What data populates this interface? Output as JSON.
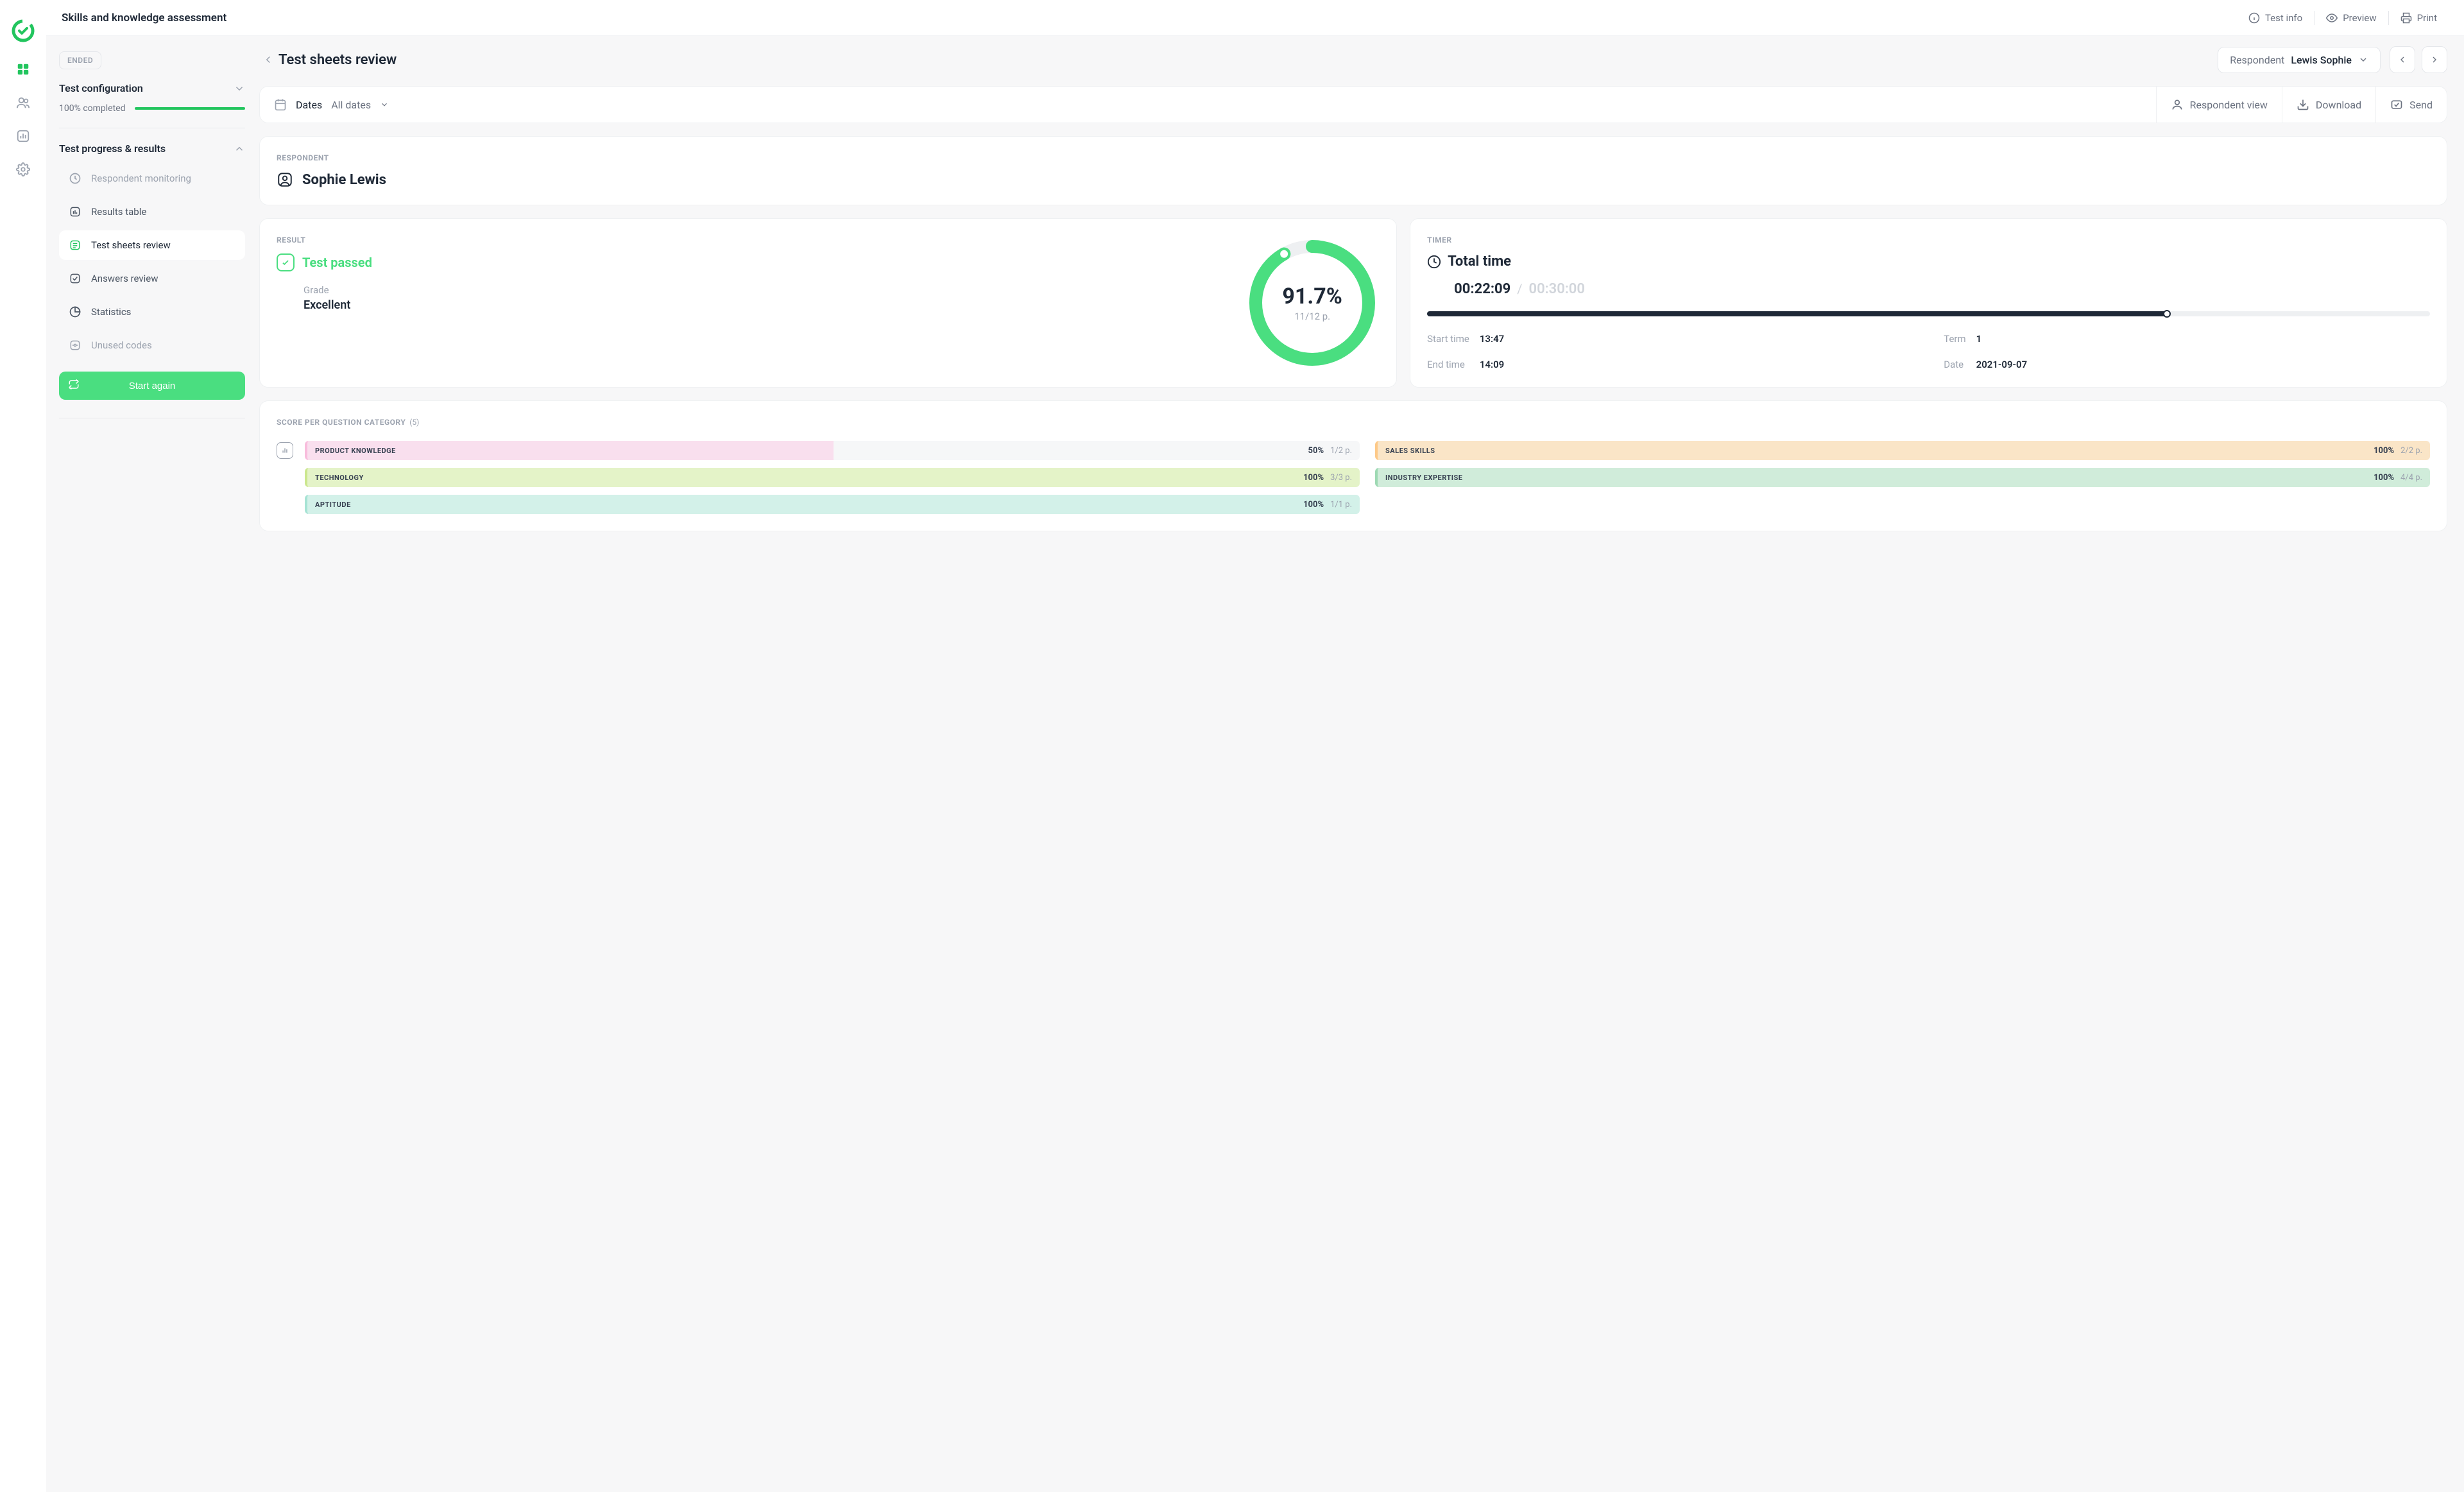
{
  "header": {
    "title": "Skills and knowledge assessment",
    "actions": {
      "test_info": "Test info",
      "preview": "Preview",
      "print": "Print"
    }
  },
  "sidebar": {
    "badge": "ENDED",
    "config": {
      "title": "Test configuration",
      "progress_text": "100% completed",
      "progress_pct": 100
    },
    "progress": {
      "title": "Test progress & results",
      "items": [
        {
          "label": "Respondent monitoring",
          "active": false
        },
        {
          "label": "Results table",
          "active": false
        },
        {
          "label": "Test sheets review",
          "active": true
        },
        {
          "label": "Answers review",
          "active": false
        },
        {
          "label": "Statistics",
          "active": false
        },
        {
          "label": "Unused codes",
          "active": false
        }
      ]
    },
    "start_again": "Start again"
  },
  "content": {
    "heading": "Test sheets review",
    "respondent_selector": {
      "label": "Respondent",
      "value": "Lewis Sophie"
    },
    "toolbar": {
      "dates_label": "Dates",
      "dates_value": "All dates",
      "respondent_view": "Respondent view",
      "download": "Download",
      "send": "Send"
    },
    "respondent_card": {
      "label": "RESPONDENT",
      "name": "Sophie Lewis"
    },
    "result_card": {
      "label": "RESULT",
      "status": "Test passed",
      "grade_label": "Grade",
      "grade_value": "Excellent",
      "percent": "91.7%",
      "points": "11/12 p.",
      "donut_pct": 91.7
    },
    "timer_card": {
      "label": "TIMER",
      "title": "Total time",
      "used": "00:22:09",
      "total": "00:30:00",
      "bar_pct": 73.8,
      "start_label": "Start time",
      "start_value": "13:47",
      "term_label": "Term",
      "term_value": "1",
      "end_label": "End time",
      "end_value": "14:09",
      "date_label": "Date",
      "date_value": "2021-09-07"
    },
    "score_card": {
      "label": "SCORE PER QUESTION CATEGORY",
      "count": "(5)",
      "categories": [
        {
          "name": "PRODUCT KNOWLEDGE",
          "percent": "50%",
          "points": "1/2 p.",
          "fill_pct": 50,
          "color": "#fbcfe8",
          "border": "#f8bcdc"
        },
        {
          "name": "TECHNOLOGY",
          "percent": "100%",
          "points": "3/3 p.",
          "fill_pct": 100,
          "color": "#d9f0a8",
          "border": "#cbe78e"
        },
        {
          "name": "APTITUDE",
          "percent": "100%",
          "points": "1/1 p.",
          "fill_pct": 100,
          "color": "#bcece0",
          "border": "#a6e3d4"
        },
        {
          "name": "SALES SKILLS",
          "percent": "100%",
          "points": "2/2 p.",
          "fill_pct": 100,
          "color": "#fed9a6",
          "border": "#fdc988"
        },
        {
          "name": "INDUSTRY EXPERTISE",
          "percent": "100%",
          "points": "4/4 p.",
          "fill_pct": 100,
          "color": "#b7e4c7",
          "border": "#9dd9b3"
        }
      ]
    }
  },
  "chart_data": [
    {
      "type": "pie",
      "title": "Result",
      "series": [
        {
          "name": "Score",
          "values": [
            91.7,
            8.3
          ]
        }
      ],
      "annotations": [
        "91.7%",
        "11/12 p."
      ]
    },
    {
      "type": "bar",
      "orientation": "horizontal",
      "title": "Score per question category",
      "categories": [
        "PRODUCT KNOWLEDGE",
        "TECHNOLOGY",
        "APTITUDE",
        "SALES SKILLS",
        "INDUSTRY EXPERTISE"
      ],
      "values": [
        50,
        100,
        100,
        100,
        100
      ],
      "unit": "%",
      "points": [
        "1/2 p.",
        "3/3 p.",
        "1/1 p.",
        "2/2 p.",
        "4/4 p."
      ]
    }
  ]
}
